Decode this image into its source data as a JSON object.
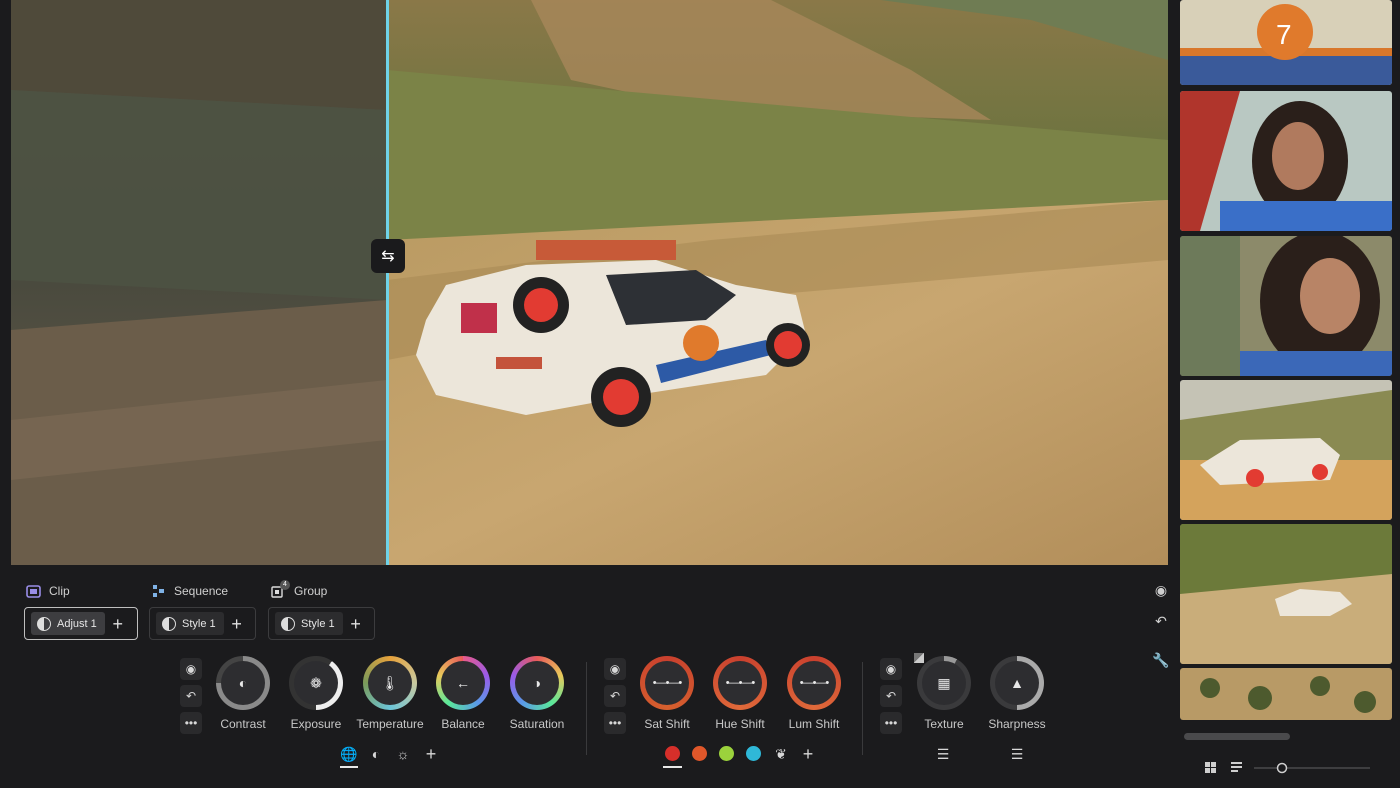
{
  "viewer": {
    "split_handle_icon": "swap-arrows-icon"
  },
  "scopes": {
    "clip": {
      "label": "Clip",
      "icon": "clip-icon"
    },
    "sequence": {
      "label": "Sequence",
      "icon": "sequence-icon"
    },
    "group": {
      "label": "Group",
      "icon": "group-icon",
      "badge": "4"
    }
  },
  "layers": {
    "clip": {
      "chip_label": "Adjust 1",
      "add_label": "+"
    },
    "sequence": {
      "chip_label": "Style 1",
      "add_label": "+"
    },
    "group": {
      "chip_label": "Style 1",
      "add_label": "+"
    }
  },
  "side_tools": [
    "eye-icon",
    "undo-icon",
    "wrench-icon"
  ],
  "panels": {
    "tone": {
      "controls": [
        "eye-icon",
        "undo-icon",
        "more-icon"
      ],
      "dials": [
        {
          "label": "Contrast",
          "icon": "contrast-icon"
        },
        {
          "label": "Exposure",
          "icon": "aperture-icon"
        },
        {
          "label": "Temperature",
          "icon": "thermometer-icon"
        },
        {
          "label": "Balance",
          "icon": "arrow-left-icon"
        },
        {
          "label": "Saturation",
          "icon": "saturation-icon"
        }
      ],
      "tabs": [
        "globe-icon",
        "half-circle-icon",
        "sun-icon",
        "plus-icon"
      ]
    },
    "color": {
      "controls": [
        "eye-icon",
        "undo-icon",
        "more-icon"
      ],
      "dials": [
        {
          "label": "Sat Shift",
          "icon": "curve-line-icon"
        },
        {
          "label": "Hue Shift",
          "icon": "curve-line-icon"
        },
        {
          "label": "Lum Shift",
          "icon": "curve-line-icon"
        }
      ],
      "swatches": [
        "#d62f2a",
        "#e0572a",
        "#9bd23c",
        "#2fb8d8"
      ],
      "extra": [
        "eyedropper-icon",
        "plus-icon"
      ]
    },
    "detail": {
      "controls": [
        "eye-icon",
        "undo-icon",
        "more-icon"
      ],
      "dials": [
        {
          "label": "Texture",
          "icon": "grid-icon"
        },
        {
          "label": "Sharpness",
          "icon": "triangle-icon"
        }
      ],
      "tabs": [
        "sliders-icon",
        "sliders-icon"
      ]
    }
  },
  "filmstrip": {
    "view_controls": [
      "grid-view-icon",
      "list-view-icon",
      "zoom-slider"
    ]
  }
}
